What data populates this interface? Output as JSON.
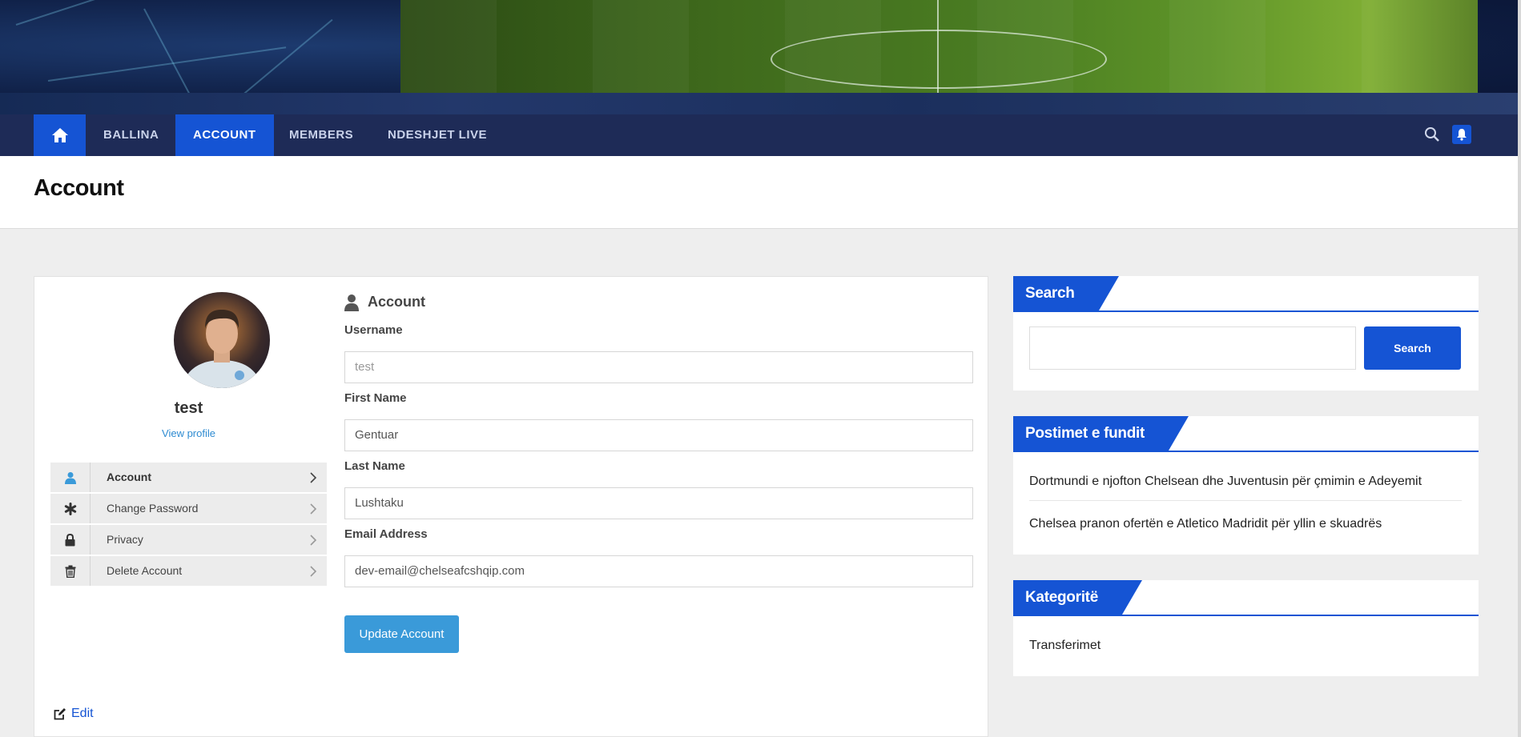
{
  "nav": {
    "items": [
      "BALLINA",
      "ACCOUNT",
      "MEMBERS",
      "NDESHJET LIVE"
    ],
    "active": "ACCOUNT",
    "accent": "#1554d4",
    "bg": "#1e2b57"
  },
  "page": {
    "title": "Account"
  },
  "profile": {
    "username": "test",
    "view_profile": "View profile",
    "menu": [
      "Account",
      "Change Password",
      "Privacy",
      "Delete Account"
    ],
    "edit": "Edit"
  },
  "form": {
    "heading": "Account",
    "username_label": "Username",
    "username_value": "test",
    "first_name_label": "First Name",
    "first_name_value": "Gentuar",
    "last_name_label": "Last Name",
    "last_name_value": "Lushtaku",
    "email_label": "Email Address",
    "email_value": "dev-email@chelseafcshqip.com",
    "submit": "Update Account"
  },
  "sidebar": {
    "search_title": "Search",
    "search_button": "Search",
    "recent_title": "Postimet e fundit",
    "recent_posts": [
      "Dortmundi e njofton Chelsean dhe Juventusin për çmimin e Adeyemit",
      "Chelsea pranon ofertën e Atletico Madridit për yllin e skuadrës"
    ],
    "categories_title": "Kategoritë",
    "categories": [
      "Transferimet"
    ]
  }
}
